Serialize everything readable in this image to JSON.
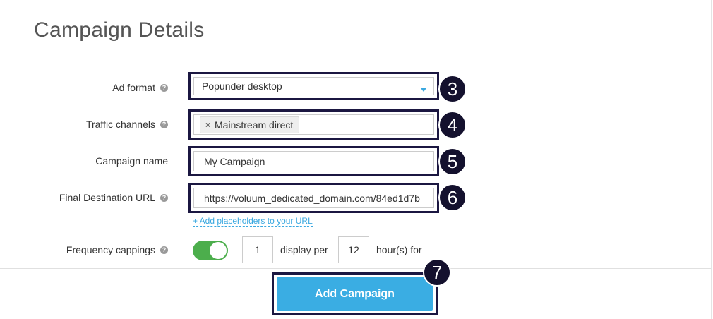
{
  "page": {
    "title": "Campaign Details"
  },
  "form": {
    "ad_format": {
      "label": "Ad format",
      "value": "Popunder desktop",
      "help_icon": "question-circle-icon"
    },
    "traffic_channels": {
      "label": "Traffic channels",
      "tag": "Mainstream direct",
      "tag_remove": "×",
      "help_icon": "question-circle-icon"
    },
    "campaign_name": {
      "label": "Campaign name",
      "value": "My Campaign"
    },
    "final_url": {
      "label": "Final Destination URL",
      "value": "https://voluum_dedicated_domain.com/84ed1d7b",
      "helper_link": "+ Add placeholders to your URL",
      "help_icon": "question-circle-icon"
    },
    "frequency_cappings": {
      "label": "Frequency cappings",
      "enabled": true,
      "count": "1",
      "display_per_text": "display per",
      "hours": "12",
      "hours_text": "hour(s) for",
      "help_icon": "question-circle-icon"
    }
  },
  "annotations": {
    "ad_format": "3",
    "traffic_channels": "4",
    "campaign_name": "5",
    "final_url": "6",
    "add_button": "7"
  },
  "footer": {
    "add_button": "Add Campaign"
  },
  "colors": {
    "accent": "#3aade3",
    "toggle_on": "#4cae4c",
    "annotation": "#14112e"
  }
}
